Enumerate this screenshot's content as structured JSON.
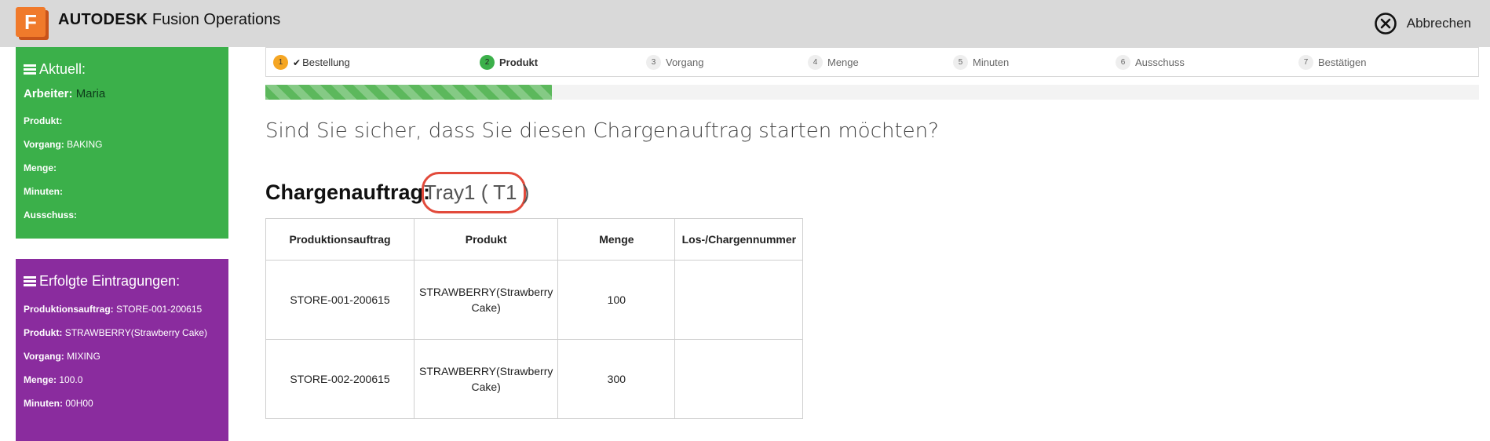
{
  "header": {
    "logo_letter": "F",
    "brand_bold": "AUTODESK",
    "brand_rest": "Fusion Operations",
    "cancel_label": "Abbrechen"
  },
  "current": {
    "title": "Aktuell:",
    "worker_label": "Arbeiter:",
    "worker_value": "Maria",
    "product_label": "Produkt:",
    "product_value": "",
    "operation_label": "Vorgang:",
    "operation_value": "BAKING",
    "quantity_label": "Menge:",
    "quantity_value": "",
    "minutes_label": "Minuten:",
    "minutes_value": "",
    "scrap_label": "Ausschuss:",
    "scrap_value": ""
  },
  "done": {
    "title": "Erfolgte Eintragungen:",
    "order_label": "Produktionsauftrag:",
    "order_value": "STORE-001-200615",
    "product_label": "Produkt:",
    "product_value": "STRAWBERRY(Strawberry Cake)",
    "operation_label": "Vorgang:",
    "operation_value": "MIXING",
    "quantity_label": "Menge:",
    "quantity_value": "100.0",
    "minutes_label": "Minuten:",
    "minutes_value": "00H00"
  },
  "steps": [
    {
      "num": "1",
      "label": "Bestellung",
      "state": "done"
    },
    {
      "num": "2",
      "label": "Produkt",
      "state": "active"
    },
    {
      "num": "3",
      "label": "Vorgang",
      "state": "todo"
    },
    {
      "num": "4",
      "label": "Menge",
      "state": "todo"
    },
    {
      "num": "5",
      "label": "Minuten",
      "state": "todo"
    },
    {
      "num": "6",
      "label": "Ausschuss",
      "state": "todo"
    },
    {
      "num": "7",
      "label": "Bestätigen",
      "state": "todo"
    }
  ],
  "progress": {
    "fraction": 0.236
  },
  "question": "Sind Sie sicher, dass Sie diesen Chargenauftrag starten möchten?",
  "batch": {
    "label": "Chargenauftrag:",
    "id": "Tray1 ( T1 )"
  },
  "table": {
    "headers": [
      "Produktionsauftrag",
      "Produkt",
      "Menge",
      "Los-/Chargennummer"
    ],
    "rows": [
      {
        "order": "STORE-001-200615",
        "product_line1": "STRAWBERRY(Strawberry",
        "product_line2": "Cake)",
        "quantity": "100",
        "lot": ""
      },
      {
        "order": "STORE-002-200615",
        "product_line1": "STRAWBERRY(Strawberry",
        "product_line2": "Cake)",
        "quantity": "300",
        "lot": ""
      }
    ]
  },
  "colors": {
    "header_bg": "#d9d9d9",
    "current_panel": "#3bb04a",
    "done_panel": "#8a2c9e",
    "progress": "#5cb85c",
    "highlight_ring": "#e24a3b",
    "logo": "#f07a2b"
  }
}
